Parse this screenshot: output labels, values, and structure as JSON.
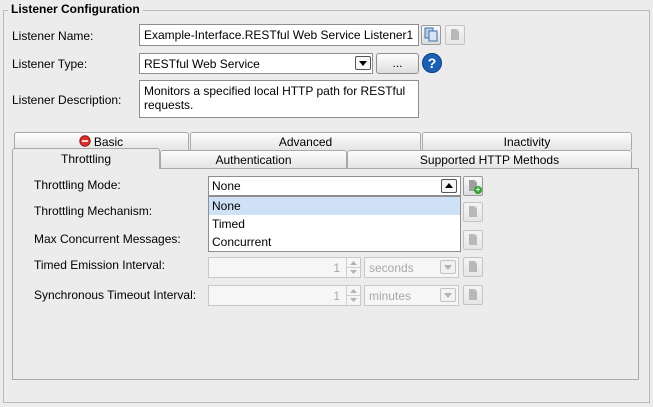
{
  "group_title": "Listener Configuration",
  "listener_name": {
    "label": "Listener Name:",
    "value": "Example-Interface.RESTful Web Service Listener1",
    "buttons": [
      "copy-icon",
      "document-icon"
    ]
  },
  "listener_type": {
    "label": "Listener Type:",
    "value": "RESTful Web Service",
    "browse_label": "...",
    "help_icon": "question-icon"
  },
  "listener_description": {
    "label": "Listener Description:",
    "value": "Monitors a specified local HTTP path for RESTful requests."
  },
  "tabs_row1": [
    {
      "label": "Basic",
      "icon": "error-icon"
    },
    {
      "label": "Advanced"
    },
    {
      "label": "Inactivity"
    }
  ],
  "tabs_row2": [
    {
      "label": "Throttling",
      "active": true
    },
    {
      "label": "Authentication"
    },
    {
      "label": "Supported HTTP Methods"
    }
  ],
  "throttling": {
    "mode_label": "Throttling Mode:",
    "mode_value": "None",
    "mode_options": [
      "None",
      "Timed",
      "Concurrent"
    ],
    "mechanism_label": "Throttling Mechanism:",
    "max_concurrent_label": "Max Concurrent Messages:",
    "timed_emission_label": "Timed Emission Interval:",
    "timed_emission_value": "1",
    "timed_emission_unit": "seconds",
    "sync_timeout_label": "Synchronous Timeout Interval:",
    "sync_timeout_value": "1",
    "sync_timeout_unit": "minutes"
  },
  "colors": {
    "background": "#ececec",
    "selection": "#cfe1f6",
    "help_blue": "#1a5fb4",
    "error_red": "#d9302c"
  }
}
